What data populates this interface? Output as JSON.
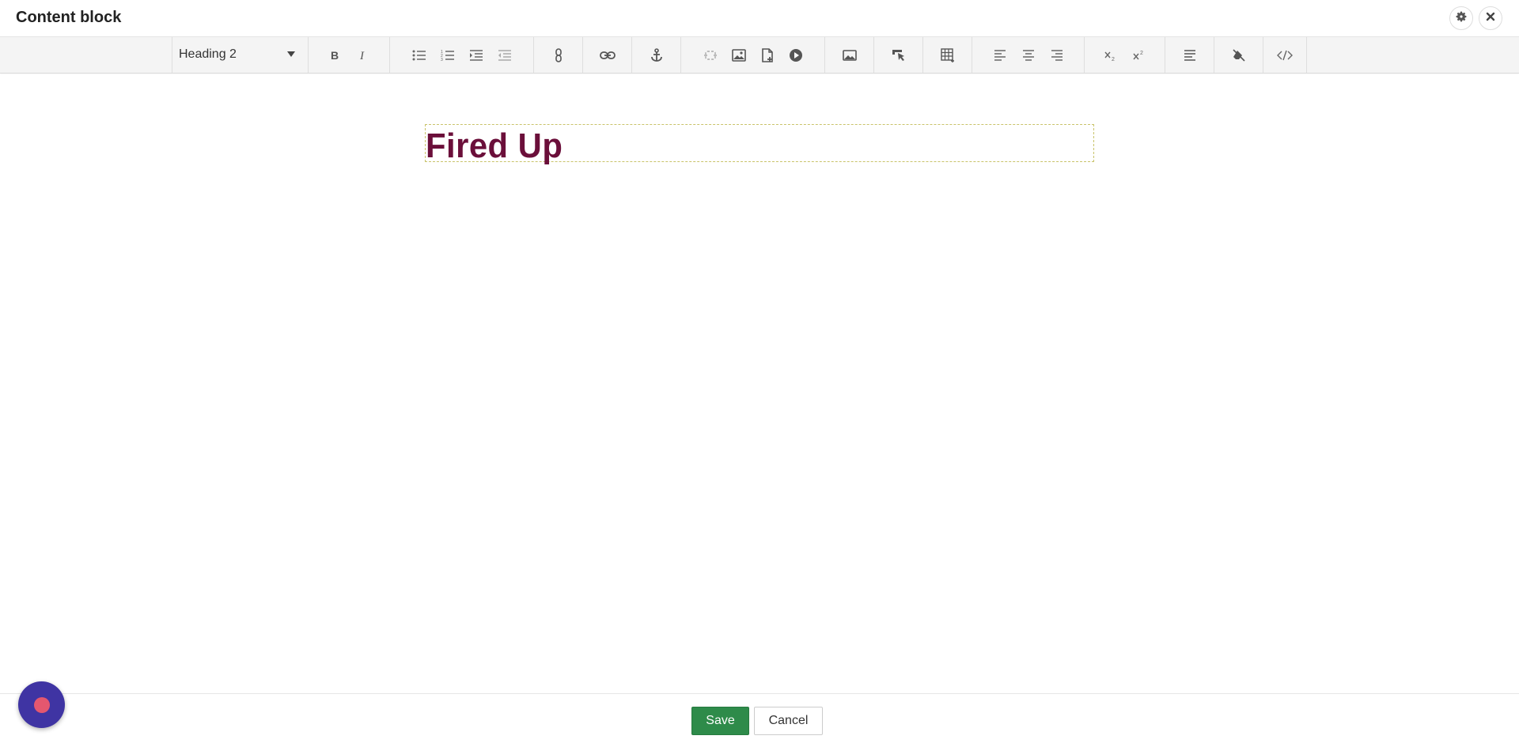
{
  "window": {
    "title": "Content block"
  },
  "toolbar": {
    "format_select": "Heading 2",
    "icons": [
      "bold-icon",
      "italic-icon",
      "bullet-list-icon",
      "numbered-list-icon",
      "indent-icon",
      "outdent-icon",
      "link-chain-icon",
      "link-icon",
      "anchor-icon",
      "embed-icon",
      "image-icon",
      "file-add-icon",
      "video-play-icon",
      "image-insert-icon",
      "cursor-pointer-icon",
      "table-icon",
      "align-left-icon",
      "align-center-icon",
      "align-right-icon",
      "subscript-icon",
      "superscript-icon",
      "paragraph-icon",
      "clear-format-icon",
      "source-code-icon"
    ]
  },
  "editor": {
    "heading_text": "Fired Up"
  },
  "footer": {
    "save_label": "Save",
    "cancel_label": "Cancel"
  },
  "colors": {
    "heading": "#6b0f3a",
    "save_button": "#2e8b4a",
    "fab": "#3f34a3",
    "fab_dot": "#e4576f"
  }
}
